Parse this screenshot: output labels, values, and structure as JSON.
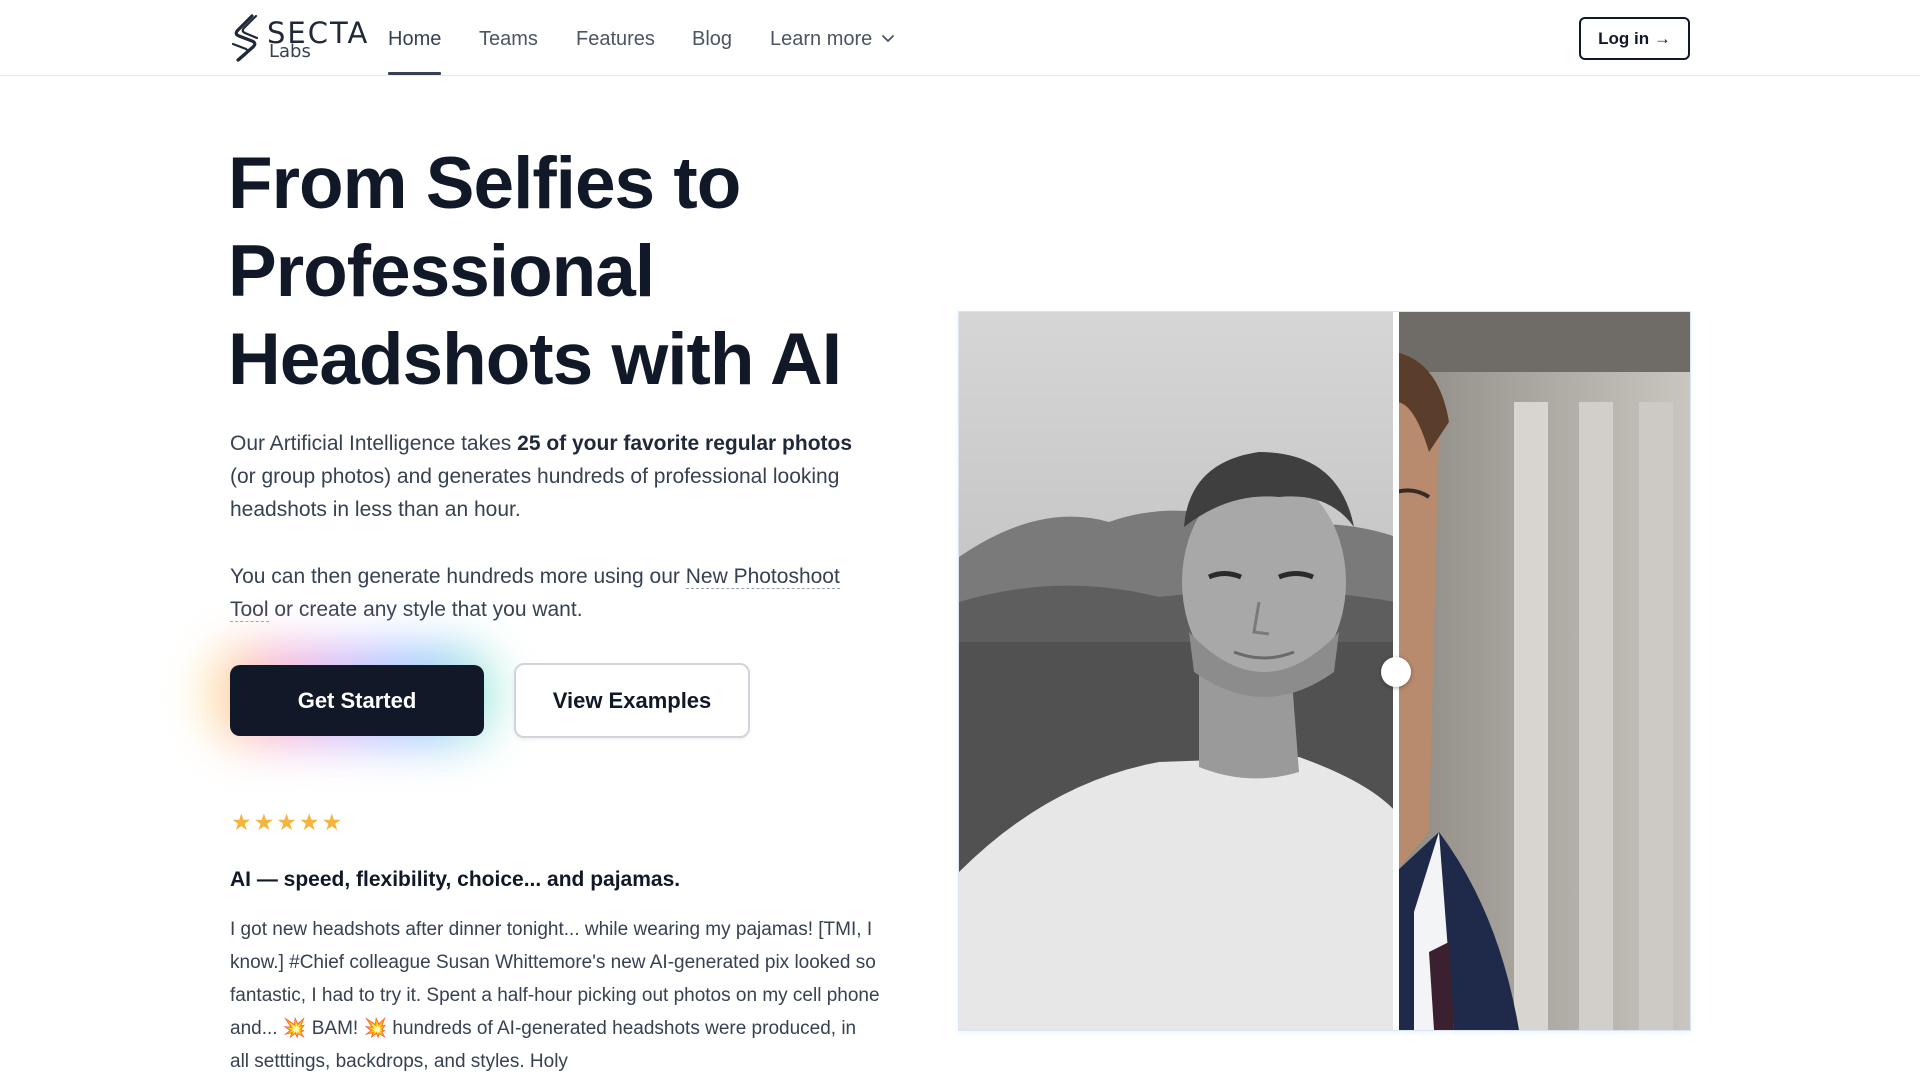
{
  "brand": {
    "name": "SECTA",
    "sub": "Labs"
  },
  "nav": {
    "items": [
      {
        "label": "Home",
        "active": true
      },
      {
        "label": "Teams"
      },
      {
        "label": "Features"
      },
      {
        "label": "Blog"
      },
      {
        "label": "Learn more"
      }
    ],
    "login_label": "Log in →"
  },
  "hero": {
    "headline_lines": [
      "From Selfies to",
      "Professional",
      "Headshots with AI"
    ],
    "p1": {
      "a": "Our Artificial Intelligence takes ",
      "bold": "25 of your favorite regular photos",
      "b": " (or group photos) and generates hundreds of professional looking headshots in less than an hour."
    },
    "p2": {
      "a": "You can then generate hundreds more using our ",
      "link": "New Photoshoot Tool",
      "b": " or create any style that you want."
    },
    "cta_primary": "Get Started",
    "cta_secondary": "View Examples"
  },
  "review": {
    "rating": 5,
    "title": "AI — speed, flexibility, choice... and pajamas.",
    "text": "I got new headshots after dinner tonight... while wearing my pajamas! [TMI, I know.] #Chief colleague Susan Whittemore's new AI-generated pix looked so fantastic, I had to try it. Spent a half-hour picking out photos on my cell phone and... 💥 BAM! 💥 hundreds of AI-generated headshots were produced, in all setttings, backdrops, and styles. Holy"
  },
  "colors": {
    "primary": "#111827",
    "star": "#f4b53f",
    "text": "#374151"
  }
}
